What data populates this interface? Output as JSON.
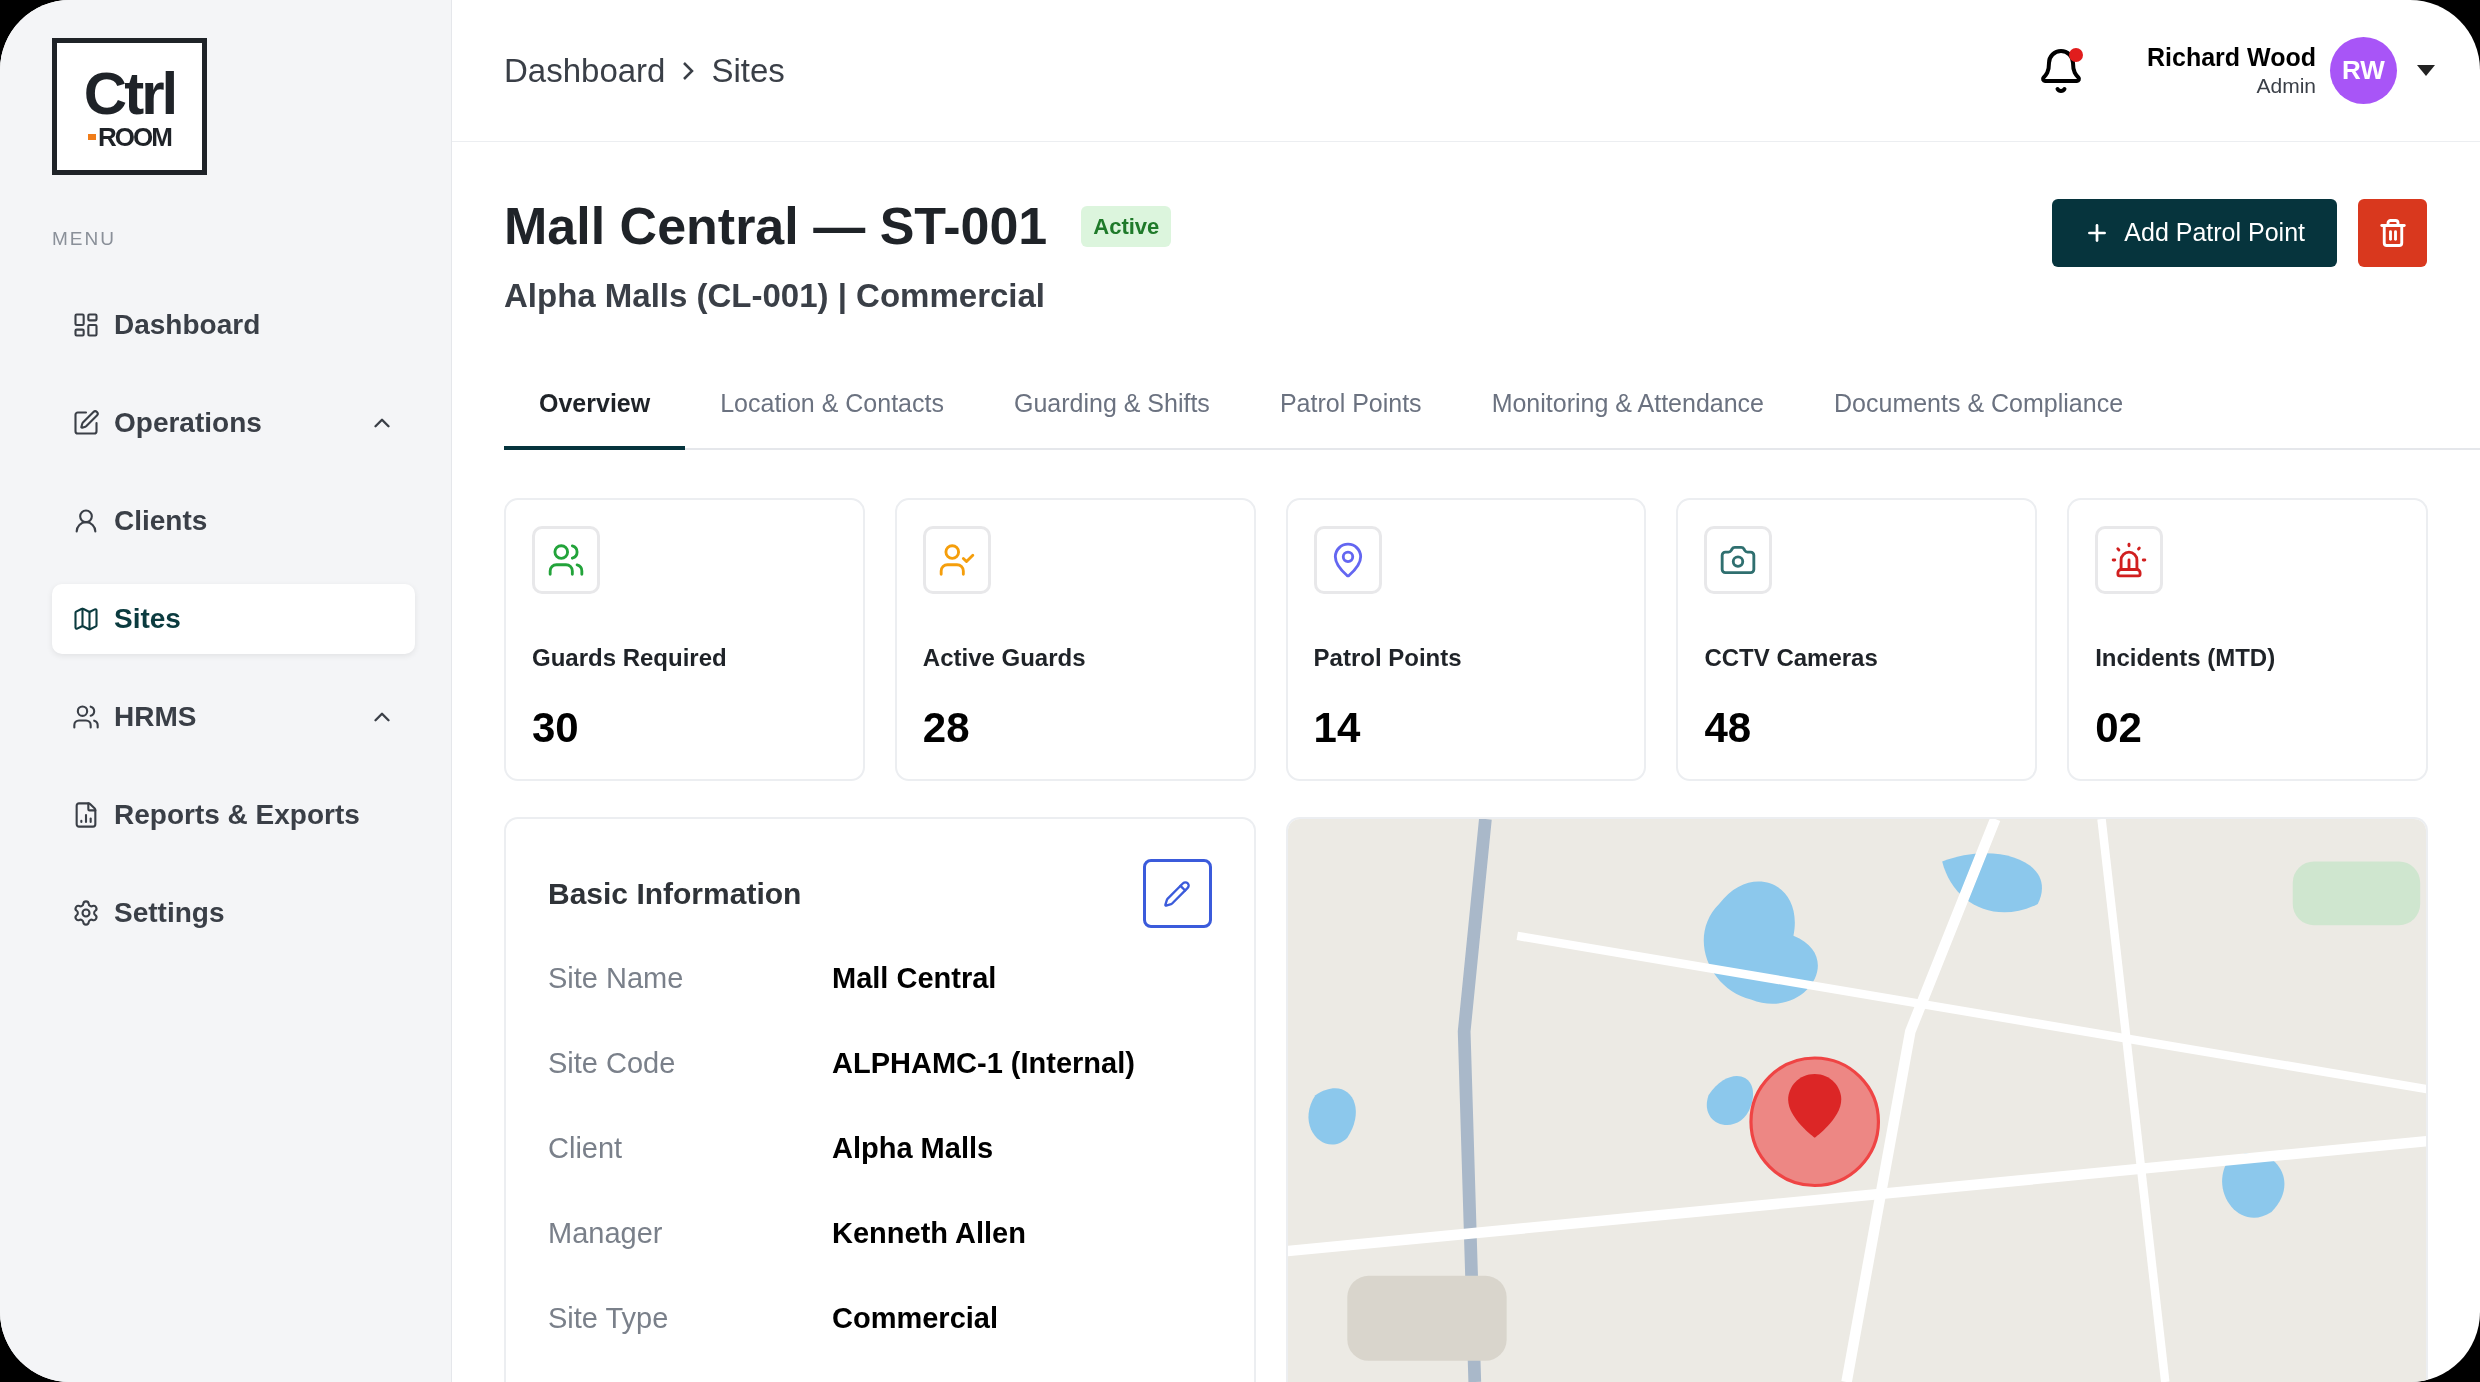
{
  "logo": {
    "line_1": "Ctrl",
    "line_2": "ROOM"
  },
  "sidebar": {
    "heading": "MENU",
    "items": [
      {
        "label": "Dashboard",
        "kind": "link",
        "selected": false
      },
      {
        "label": "Operations",
        "kind": "group",
        "expanded": true,
        "selected": false
      },
      {
        "label": "Clients",
        "kind": "link",
        "selected": false
      },
      {
        "label": "Sites",
        "kind": "link",
        "selected": true
      },
      {
        "label": "HRMS",
        "kind": "group",
        "expanded": true,
        "selected": false
      },
      {
        "label": "Reports & Exports",
        "kind": "link",
        "selected": false
      },
      {
        "label": "Settings",
        "kind": "link",
        "selected": false
      }
    ]
  },
  "breadcrumb": [
    "Dashboard",
    "Sites"
  ],
  "header": {
    "has_notification": true,
    "user_name": "Richard Wood",
    "user_role": "Admin",
    "avatar_initials": "RW"
  },
  "site": {
    "title": "Mall Central — ST-001",
    "status": "Active",
    "subtitle": "Alpha Malls (CL-001) | Commercial"
  },
  "actions": {
    "add_label": "Add Patrol Point"
  },
  "tabs": [
    {
      "label": "Overview",
      "selected": true
    },
    {
      "label": "Location & Contacts",
      "selected": false
    },
    {
      "label": "Guarding & Shifts",
      "selected": false
    },
    {
      "label": "Patrol Points",
      "selected": false
    },
    {
      "label": "Monitoring & Attendance",
      "selected": false
    },
    {
      "label": "Documents & Compliance",
      "selected": false
    }
  ],
  "stats": [
    {
      "label": "Guards Required",
      "value": "30",
      "color": "#22a33a"
    },
    {
      "label": "Active Guards",
      "value": "28",
      "color": "#f59e0b"
    },
    {
      "label": "Patrol Points",
      "value": "14",
      "color": "#6366f1"
    },
    {
      "label": "CCTV Cameras",
      "value": "48",
      "color": "#2f6f6f"
    },
    {
      "label": "Incidents (MTD)",
      "value": "02",
      "color": "#d11f1f"
    }
  ],
  "basic_info": {
    "title": "Basic Information",
    "rows": [
      {
        "label": "Site Name",
        "value": "Mall Central"
      },
      {
        "label": "Site Code",
        "value": "ALPHAMC-1 (Internal)"
      },
      {
        "label": "Client",
        "value": "Alpha Malls"
      },
      {
        "label": "Manager",
        "value": "Kenneth Allen"
      },
      {
        "label": "Site Type",
        "value": "Commercial"
      }
    ]
  }
}
